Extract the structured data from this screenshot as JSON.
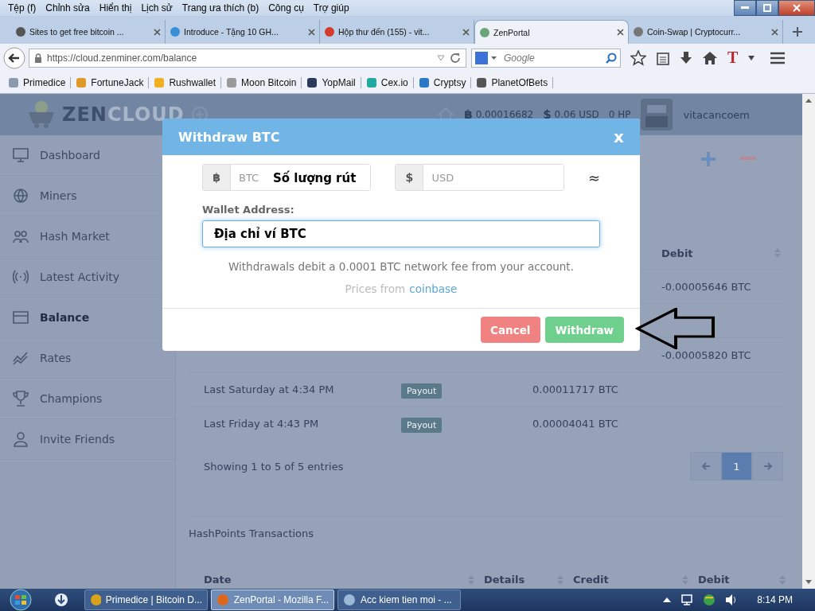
{
  "menu_bar": {
    "items": [
      "Tệp (f)",
      "Chỉnh sửa",
      "Hiển thị",
      "Lịch sử",
      "Trang ưa thích (b)",
      "Công cụ",
      "Trợ giúp"
    ]
  },
  "tabs": [
    {
      "title": "Sites to get free bitcoin ...",
      "selected": false,
      "color": "#555555"
    },
    {
      "title": "Introduce - Tặng 10 GH...",
      "selected": false,
      "color": "#3a8fd8"
    },
    {
      "title": "Hộp thư đến (155) - vit...",
      "selected": false,
      "color": "#d33b2c"
    },
    {
      "title": "ZenPortal",
      "selected": true,
      "color": "#6aa57a"
    },
    {
      "title": "Coin-Swap | Cryptocurr...",
      "selected": false,
      "color": "#777777"
    }
  ],
  "nav": {
    "url": "https://cloud.zenminer.com/balance",
    "search_placeholder": "Google",
    "toolbar_letter": "T"
  },
  "bookmarks": [
    {
      "label": "Primedice",
      "color": "#8a9bb0"
    },
    {
      "label": "FortuneJack",
      "color": "#e09a2a"
    },
    {
      "label": "Rushwallet",
      "color": "#f0b020"
    },
    {
      "label": "Moon Bitcoin",
      "color": "#9a9a9a"
    },
    {
      "label": "YopMail",
      "color": "#2b3a5a"
    },
    {
      "label": "Cex.io",
      "color": "#1fa9a0"
    },
    {
      "label": "Cryptsy",
      "color": "#2a78c8"
    },
    {
      "label": "PlanetOfBets",
      "color": "#555555"
    }
  ],
  "header": {
    "logo_part_1": "ZEN",
    "logo_part_2": "CLOUD",
    "btc_symbol": "฿",
    "usd_symbol": "$",
    "btc_balance": "0.00016682",
    "usd_balance": "0.06 USD",
    "hashpoints": "0 HP",
    "username": "vitacancoem"
  },
  "sidebar": {
    "items": [
      {
        "label": "Dashboard",
        "selected": false
      },
      {
        "label": "Miners",
        "selected": false
      },
      {
        "label": "Hash Market",
        "selected": false
      },
      {
        "label": "Latest Activity",
        "selected": false
      },
      {
        "label": "Balance",
        "selected": true
      },
      {
        "label": "Rates",
        "selected": false
      },
      {
        "label": "Champions",
        "selected": false
      },
      {
        "label": "Invite Friends",
        "selected": false
      }
    ]
  },
  "balance_table": {
    "columns": [
      "Debit"
    ],
    "rows": [
      {
        "debit": "-0.00005646 BTC"
      },
      {},
      {
        "debit": "-0.00005820 BTC"
      },
      {
        "date": "Last Saturday at 4:34 PM",
        "details": "Payout",
        "credit": "0.00011717 BTC"
      },
      {
        "date": "Last Friday at 4:43 PM",
        "details": "Payout",
        "credit": "0.00004041 BTC"
      }
    ],
    "info": "Showing 1 to 5 of 5 entries",
    "pages": [
      {
        "label": "1",
        "selected": true
      }
    ]
  },
  "hashpoints": {
    "title": "HashPoints Transactions",
    "columns": [
      "Date",
      "Details",
      "Credit",
      "Debit"
    ]
  },
  "modal": {
    "title": "Withdraw BTC",
    "close": "x",
    "btc_addon": "฿",
    "btc_placeholder": "BTC",
    "amount_note": "Số lượng rút",
    "usd_addon": "$",
    "usd_placeholder": "USD",
    "approx": "≈",
    "wallet_label": "Wallet Address:",
    "wallet_value": "Địa chỉ ví BTC",
    "fee_note": "Withdrawals debit a 0.0001 BTC network fee from your account.",
    "prices_text": "Prices from",
    "prices_link": "coinbase",
    "cancel": "Cancel",
    "withdraw": "Withdraw"
  },
  "taskbar": {
    "tasks": [
      {
        "title": "Primedice | Bitcoin D...",
        "selected": false,
        "color": "#d9a21b"
      },
      {
        "title": "ZenPortal - Mozilla F...",
        "selected": true,
        "color": "#e0661c"
      },
      {
        "title": "Acc kiem tien moi - ...",
        "selected": false,
        "color": "#9ab8d8"
      }
    ],
    "clock": "8:14 PM"
  }
}
